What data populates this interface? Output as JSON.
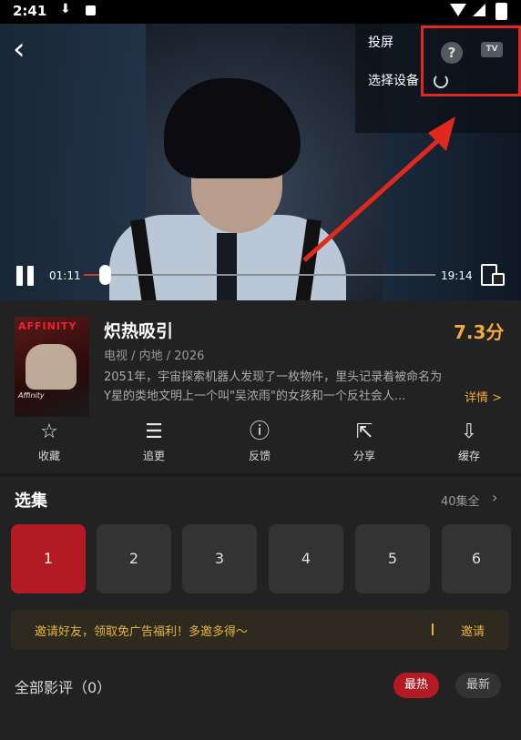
{
  "status_bar": {
    "time": "2:41"
  },
  "player": {
    "cast_title": "投屏",
    "select_device": "选择设备",
    "tv_label": "TV",
    "help_label": "?",
    "current_time": "01:11",
    "total_time": "19:14",
    "progress": 0.06
  },
  "show": {
    "poster_title": "AFFINITY",
    "poster_subtitle": "Affinity",
    "title": "炽热吸引",
    "score": "7.3分",
    "meta": "电视 / 内地 / 2026",
    "description_line1": "2051年，宇宙探索机器人发现了一枚物件，里头记录着被命名为",
    "description_line2": "Y星的类地文明上一个叫\"吴浓雨\"的女孩和一个反社会人...",
    "more_label": "详情 >"
  },
  "actions": [
    {
      "label": "收藏",
      "icon": "star-icon"
    },
    {
      "label": "追更",
      "icon": "follow-icon"
    },
    {
      "label": "反馈",
      "icon": "feedback-icon"
    },
    {
      "label": "分享",
      "icon": "share-icon"
    },
    {
      "label": "缓存",
      "icon": "download-icon"
    }
  ],
  "episodes": {
    "title": "选集",
    "count": "40集全",
    "items": [
      "1",
      "2",
      "3",
      "4",
      "5",
      "6"
    ],
    "active_index": 0
  },
  "invite": {
    "text": "邀请好友，领取免广告福利！多邀多得～",
    "button": "邀请"
  },
  "reviews": {
    "title": "全部影评（0）",
    "sort_hot": "最热",
    "sort_new": "最新"
  },
  "colors": {
    "accent_red": "#b31a23",
    "accent_gold": "#f0a93a",
    "annotation_red": "#e0281c"
  }
}
